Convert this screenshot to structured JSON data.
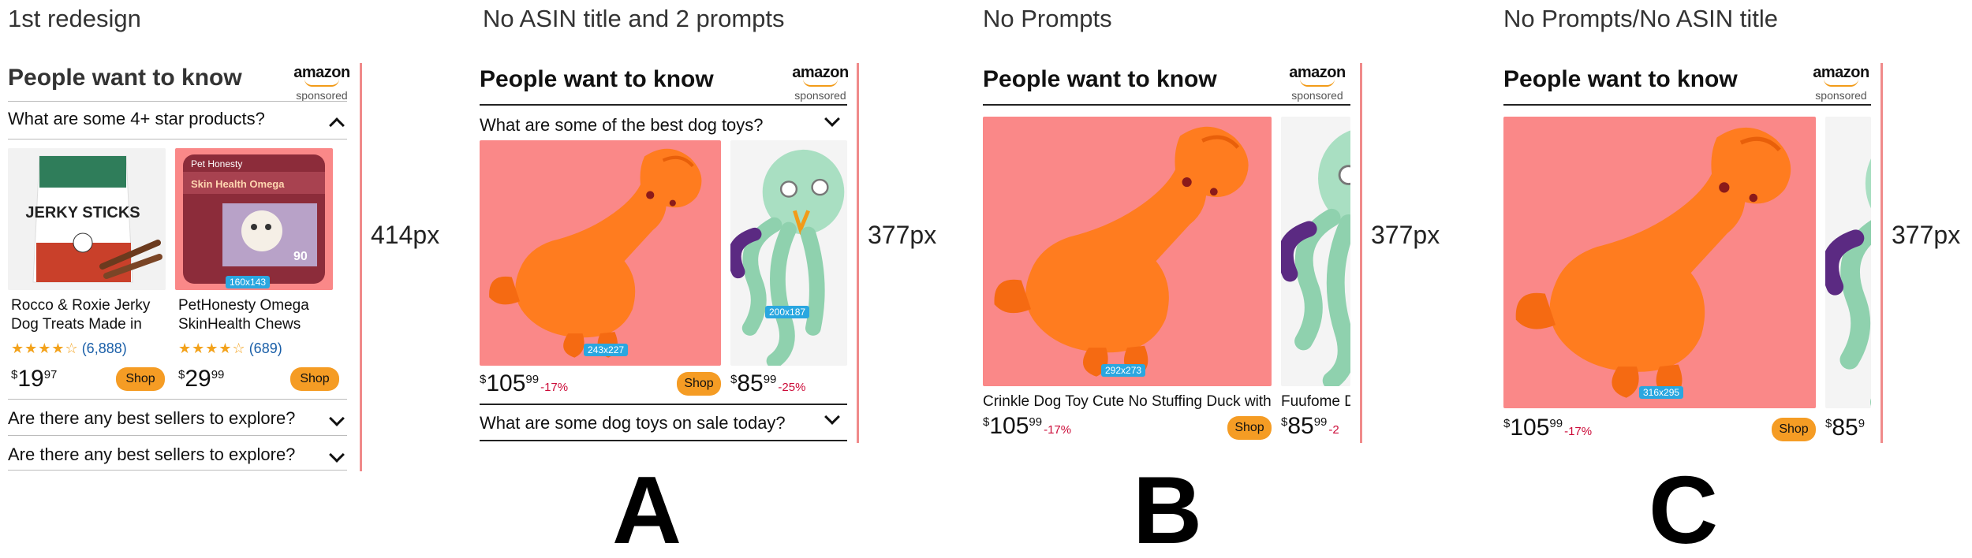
{
  "captions": {
    "first": "1st redesign",
    "a": "No ASIN title and 2 prompts",
    "b": "No Prompts",
    "c": "No Prompts/No ASIN title"
  },
  "heights": {
    "first": "414px",
    "a": "377px",
    "b": "377px",
    "c": "377px"
  },
  "letters": {
    "a": "A",
    "b": "B",
    "c": "C"
  },
  "common": {
    "title": "People want to know",
    "logo": "amazon",
    "sponsored": "sponsored",
    "shop": "Shop"
  },
  "first": {
    "prompt_open": "What are some 4+ star products?",
    "products": [
      {
        "name_line1": "Rocco & Roxie Jerky",
        "name_line2": "Dog Treats Made in",
        "stars": "★★★★☆",
        "count": "(6,888)",
        "price_cur": "$",
        "price_whole": "19",
        "price_frac": "97",
        "package_title": "JERKY STICKS"
      },
      {
        "name_line1": "PetHonesty Omega",
        "name_line2": "SkinHealth Chews",
        "stars": "★★★★☆",
        "count": "(689)",
        "price_cur": "$",
        "price_whole": "29",
        "price_frac": "99",
        "badge": "160x143",
        "package_title": "Skin Health Omega",
        "package_brand": "Pet Honesty",
        "package_count": "90"
      }
    ],
    "prompt2": "Are there any best sellers to explore?",
    "prompt3": "Are there any best sellers to explore?"
  },
  "a": {
    "prompt1": "What are some of the best dog toys?",
    "prompt2": "What are some dog toys on sale today?",
    "badge1": "243x227",
    "badge2": "200x187",
    "price1": {
      "cur": "$",
      "whole": "105",
      "frac": "99",
      "disc": "-17%"
    },
    "price2": {
      "cur": "$",
      "whole": "85",
      "frac": "99",
      "disc": "-25%"
    }
  },
  "b": {
    "badge": "292x273",
    "name1": "Crinkle Dog Toy Cute No Stuffing Duck with",
    "name2": "Fuufome D",
    "price1": {
      "cur": "$",
      "whole": "105",
      "frac": "99",
      "disc": "-17%"
    },
    "price2": {
      "cur": "$",
      "whole": "85",
      "frac": "99",
      "disc": "-2"
    }
  },
  "c": {
    "badge": "316x295",
    "price1": {
      "cur": "$",
      "whole": "105",
      "frac": "99",
      "disc": "-17%"
    },
    "price2": {
      "cur": "$",
      "whole": "85",
      "frac": "9"
    }
  },
  "colors": {
    "accent_line": "#f08a8a",
    "shop_button": "#f59c24",
    "discount": "#cc0c39",
    "badge": "#2aa7e0",
    "duck_bg": "#fa8888",
    "duck": "#ff7c1f"
  }
}
